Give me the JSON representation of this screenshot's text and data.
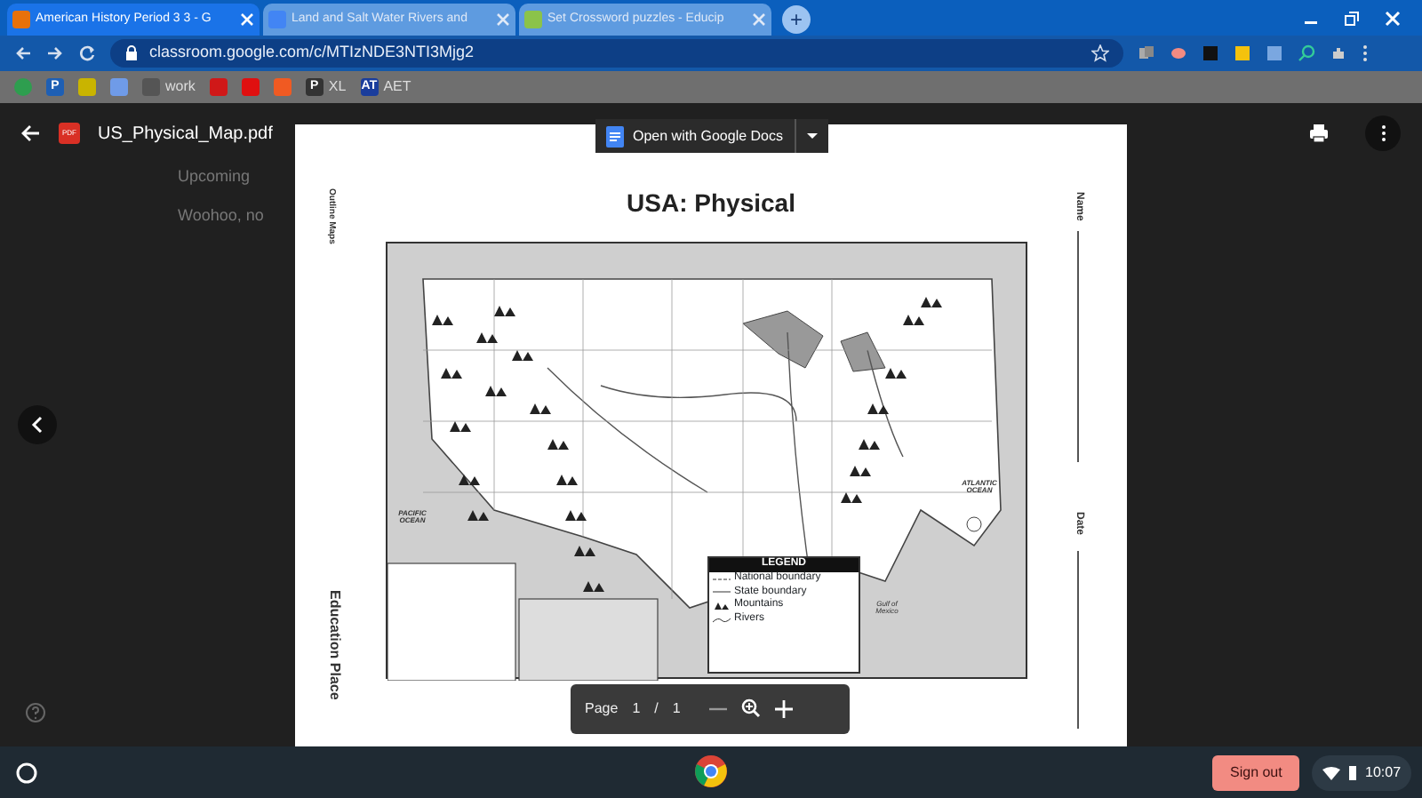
{
  "browser": {
    "tabs": [
      {
        "title": "American History Period 3 3 - G",
        "selected": true,
        "color": "#e8710a"
      },
      {
        "title": "Land and Salt Water Rivers and",
        "selected": false,
        "color": "#4285f4"
      },
      {
        "title": "Set Crossword puzzles - Educip",
        "selected": false,
        "color": "#8bc34a"
      }
    ],
    "new_tab": "+",
    "url": "classroom.google.com/c/MTIzNDE3NTI3Mjg2",
    "bookmarks": [
      {
        "color": "#2e9e4f"
      },
      {
        "color": "#1e5fb4",
        "glyph": "P"
      },
      {
        "color": "#c9b400"
      },
      {
        "color": "#6f9be8"
      },
      {
        "color": "#555555",
        "label": "work"
      },
      {
        "color": "#d01818"
      },
      {
        "color": "#e01010"
      },
      {
        "color": "#f05a22"
      },
      {
        "color": "#333333",
        "glyph": "P",
        "label": "XL"
      },
      {
        "color": "#1a3d9c",
        "glyph": "AT",
        "label": "AET"
      }
    ]
  },
  "background": {
    "texts": [
      "Upcoming",
      "Woohoo, no"
    ]
  },
  "viewer": {
    "file_name": "US_Physical_Map.pdf",
    "file_badge": "PDF",
    "open_with": "Open with Google Docs",
    "page_label": "Page",
    "page": "1",
    "separator": "/",
    "total": "1"
  },
  "document": {
    "title": "USA: Physical",
    "publisher_top": "Outline Maps",
    "publisher_bottom": "Education Place",
    "fields": [
      "Name",
      "Date"
    ],
    "map_labels": [
      {
        "text": "PACIFIC OCEAN",
        "kind": "ocean"
      },
      {
        "text": "ATLANTIC OCEAN",
        "kind": "ocean"
      },
      {
        "text": "Gulf of Mexico",
        "kind": "gulf"
      }
    ],
    "legend": {
      "title": "LEGEND",
      "items": [
        {
          "text": "National boundary",
          "kind": "dash"
        },
        {
          "text": "State boundary",
          "kind": "line"
        },
        {
          "text": "Mountains",
          "kind": "mountain"
        },
        {
          "text": "Rivers",
          "kind": "river"
        }
      ]
    }
  },
  "taskbar": {
    "sign_out": "Sign out",
    "time": "10:07"
  }
}
